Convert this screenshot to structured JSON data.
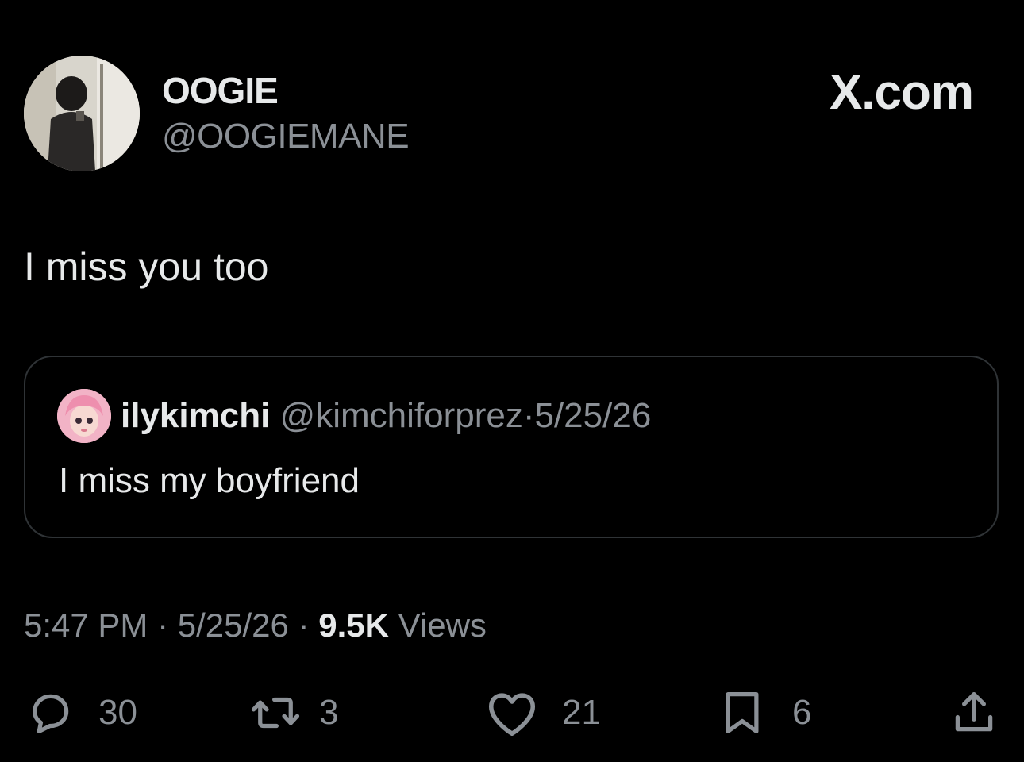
{
  "author": {
    "display_name": "OOGIE",
    "handle": "@OOGIEMANE"
  },
  "brand": "X.com",
  "tweet": {
    "text": "I miss you too"
  },
  "quoted_tweet": {
    "display_name": "ilykimchi",
    "handle": "@kimchiforprez",
    "separator": "·",
    "date": "5/25/26",
    "text": "I miss my boyfriend"
  },
  "meta": {
    "time": "5:47 PM",
    "separator": "·",
    "date": "5/25/26",
    "views_count": "9.5K",
    "views_label": "Views"
  },
  "actions": {
    "replies": "30",
    "reposts": "3",
    "likes": "21",
    "bookmarks": "6"
  },
  "icons": [
    "reply-icon",
    "repost-icon",
    "like-icon",
    "bookmark-icon",
    "share-icon"
  ]
}
